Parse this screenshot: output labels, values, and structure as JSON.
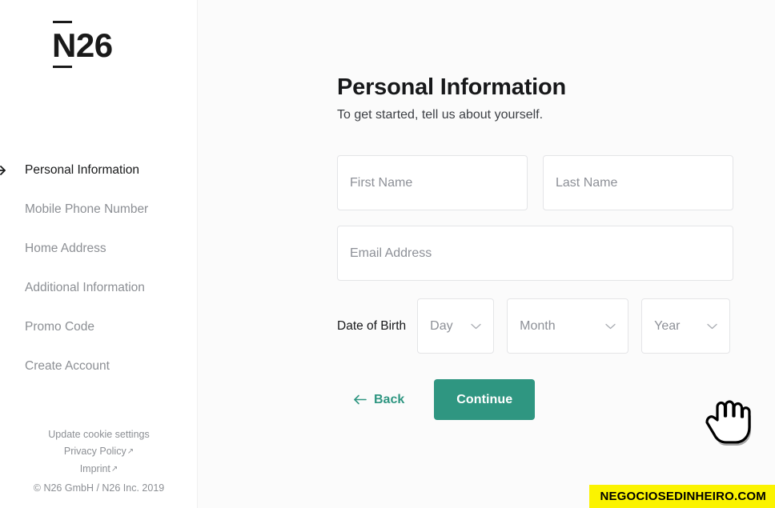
{
  "brand": {
    "logo_text": "N26",
    "accent_color": "#2f9681",
    "text_color": "#17181a"
  },
  "sidebar": {
    "nav_items": [
      {
        "label": "Personal Information",
        "active": true
      },
      {
        "label": "Mobile Phone Number",
        "active": false
      },
      {
        "label": "Home Address",
        "active": false
      },
      {
        "label": "Additional Information",
        "active": false
      },
      {
        "label": "Promo Code",
        "active": false
      },
      {
        "label": "Create Account",
        "active": false
      }
    ],
    "footer": {
      "cookie_settings": "Update cookie settings",
      "privacy_policy": "Privacy Policy",
      "imprint": "Imprint",
      "external_marker": "↗",
      "copyright": "© N26 GmbH / N26 Inc. 2019"
    }
  },
  "main": {
    "title": "Personal Information",
    "subtitle": "To get started, tell us about yourself.",
    "fields": {
      "first_name_placeholder": "First Name",
      "last_name_placeholder": "Last Name",
      "email_placeholder": "Email Address",
      "first_name_value": "",
      "last_name_value": "",
      "email_value": ""
    },
    "date_of_birth": {
      "label": "Date of Birth",
      "day_selected": "Day",
      "month_selected": "Month",
      "year_selected": "Year"
    },
    "actions": {
      "back_label": "Back",
      "continue_label": "Continue"
    }
  },
  "watermark": {
    "text": "NEGOCIOSEDINHEIRO.COM",
    "background_color": "#fbf300",
    "text_color": "#000000"
  }
}
